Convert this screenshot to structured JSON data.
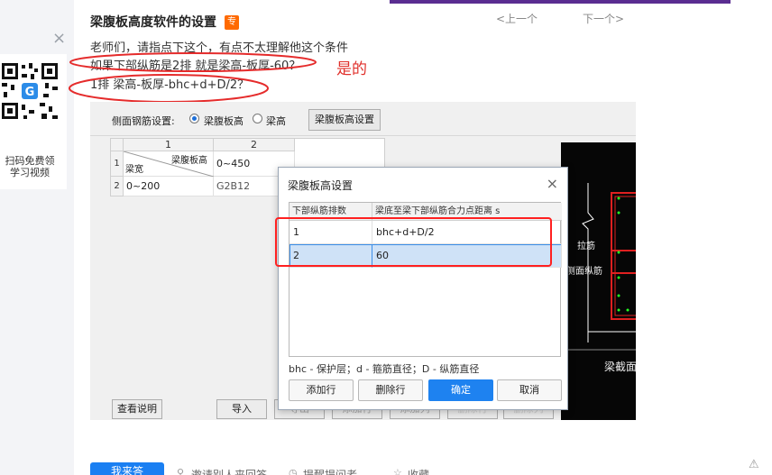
{
  "side_panel": {
    "close_glyph": "×",
    "qr_line1": "扫码免费领",
    "qr_line2": "学习视频"
  },
  "pager": {
    "prev": "<上一个",
    "next": "下一个>"
  },
  "question": {
    "title": "梁腹板高度软件的设置",
    "badge": "专",
    "line1": "老师们，请指点下这个，有点不太理解他这个条件",
    "line2": "如果下部纵筋是2排  就是梁高-板厚-60？",
    "line3": "1排 梁高-板厚-bhc+d+D/2？",
    "annotation": "是的"
  },
  "screenshot": {
    "toolbar_label": "侧面钢筋设置:",
    "radio1": "梁腹板高",
    "radio2": "梁高",
    "settings_button": "梁腹板高设置",
    "grid": {
      "col_headers": [
        "1",
        "2"
      ],
      "row_numbers": [
        "1",
        "2"
      ],
      "diag_top": "梁腹板高",
      "diag_bottom": "梁宽",
      "r1c2": "0~450",
      "r2c1": "0~200",
      "r2c2": "G2B12"
    },
    "black_labels": [
      "拉筋",
      "侧面纵筋",
      "梁截面"
    ],
    "bottom_buttons": [
      "查看说明",
      "导入",
      "导出",
      "添加行",
      "添加列",
      "删除行",
      "删除列"
    ],
    "dialog": {
      "title": "梁腹板高设置",
      "close": "×",
      "col1": "下部纵筋排数",
      "col2": "梁底至梁下部纵筋合力点距离 s",
      "rows": [
        {
          "count": "1",
          "value": "bhc+d+D/2"
        },
        {
          "count": "2",
          "value": "60"
        }
      ],
      "legend": "bhc - 保护层；d - 箍筋直径；D - 纵筋直径",
      "buttons": {
        "add": "添加行",
        "delete": "删除行",
        "ok": "确定",
        "cancel": "取消"
      }
    }
  },
  "footer": {
    "answer_button": "我来答",
    "invite": "邀请别人来回答",
    "remind": "提醒提问者",
    "favorite": "收藏"
  },
  "colors": {
    "accent_blue": "#1a7ff2",
    "annotation_red": "#e0302b",
    "pager_purple": "#5a2d91"
  }
}
